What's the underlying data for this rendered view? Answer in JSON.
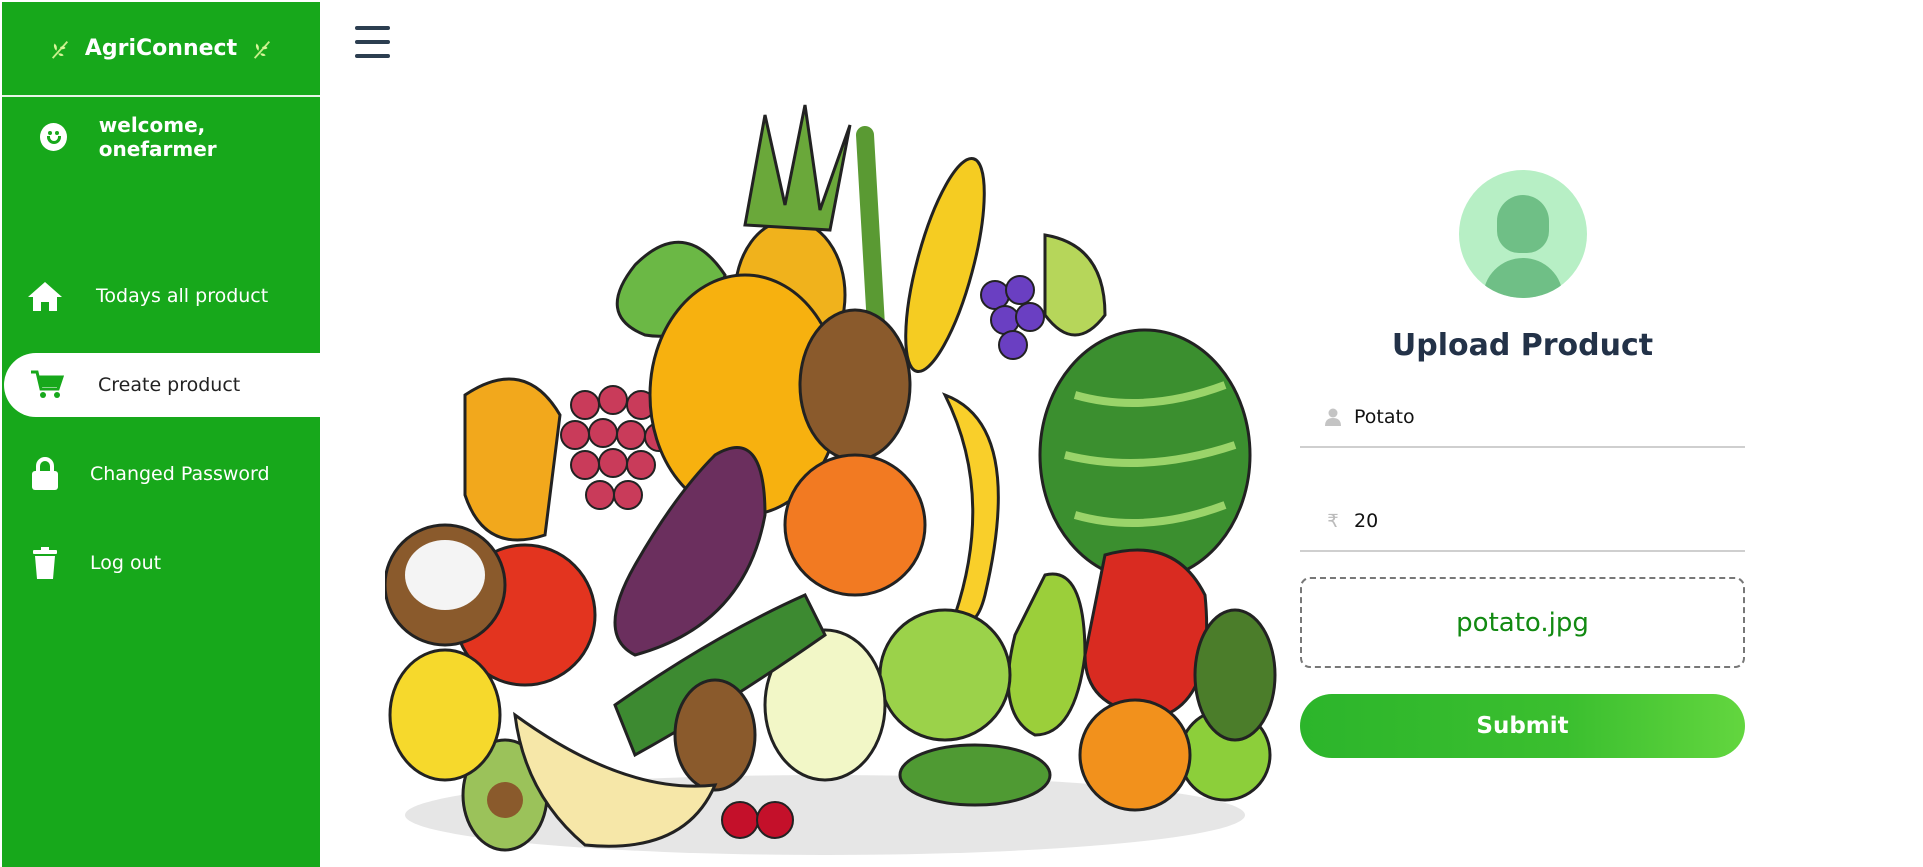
{
  "sidebar": {
    "brand": "AgriConnect",
    "welcome": "welcome, onefarmer",
    "items": [
      {
        "label": "Todays all product",
        "icon": "home-icon"
      },
      {
        "label": "Create product",
        "icon": "cart-icon"
      },
      {
        "label": "Changed Password",
        "icon": "lock-icon"
      },
      {
        "label": "Log out",
        "icon": "trash-icon"
      }
    ]
  },
  "form": {
    "title": "Upload Product",
    "name_value": "Potato",
    "price_value": "20",
    "currency_symbol": "₹",
    "file_name": "potato.jpg",
    "submit_label": "Submit"
  },
  "colors": {
    "sidebar": "#17a81b",
    "title": "#233248",
    "file_text": "#128a12"
  }
}
